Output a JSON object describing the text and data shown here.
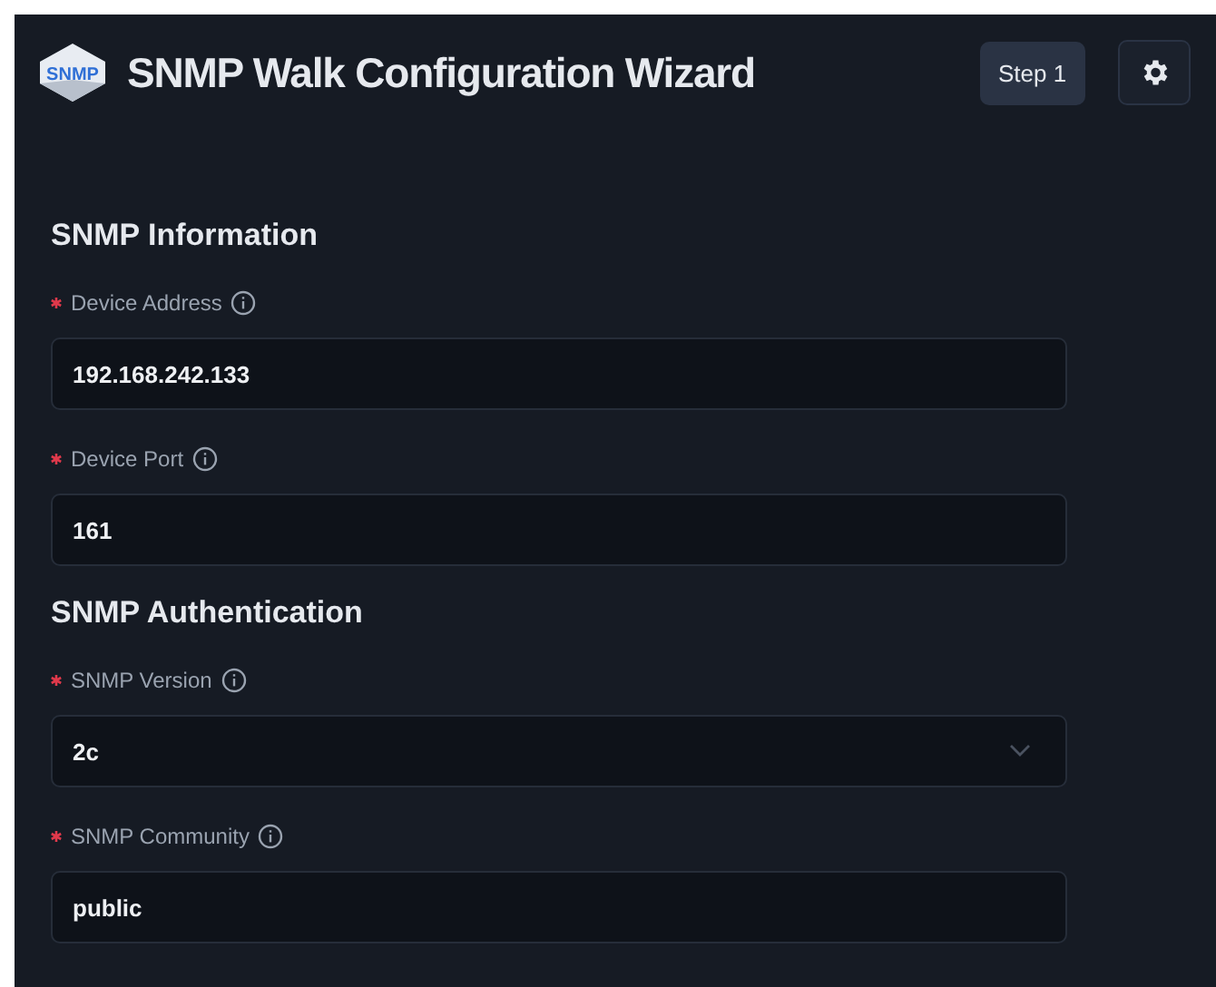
{
  "header": {
    "logo_text": "SNMP",
    "title": "SNMP Walk Configuration Wizard",
    "step": "Step 1"
  },
  "sections": [
    {
      "title": "SNMP Information",
      "fields": [
        {
          "label": "Device Address",
          "required": true,
          "kind": "text",
          "value": "192.168.242.133"
        },
        {
          "label": "Device Port",
          "required": true,
          "kind": "text",
          "value": "161"
        }
      ]
    },
    {
      "title": "SNMP Authentication",
      "fields": [
        {
          "label": "SNMP Version",
          "required": true,
          "kind": "select",
          "value": "2c"
        },
        {
          "label": "SNMP Community",
          "required": true,
          "kind": "text",
          "value": "public"
        }
      ]
    }
  ]
}
